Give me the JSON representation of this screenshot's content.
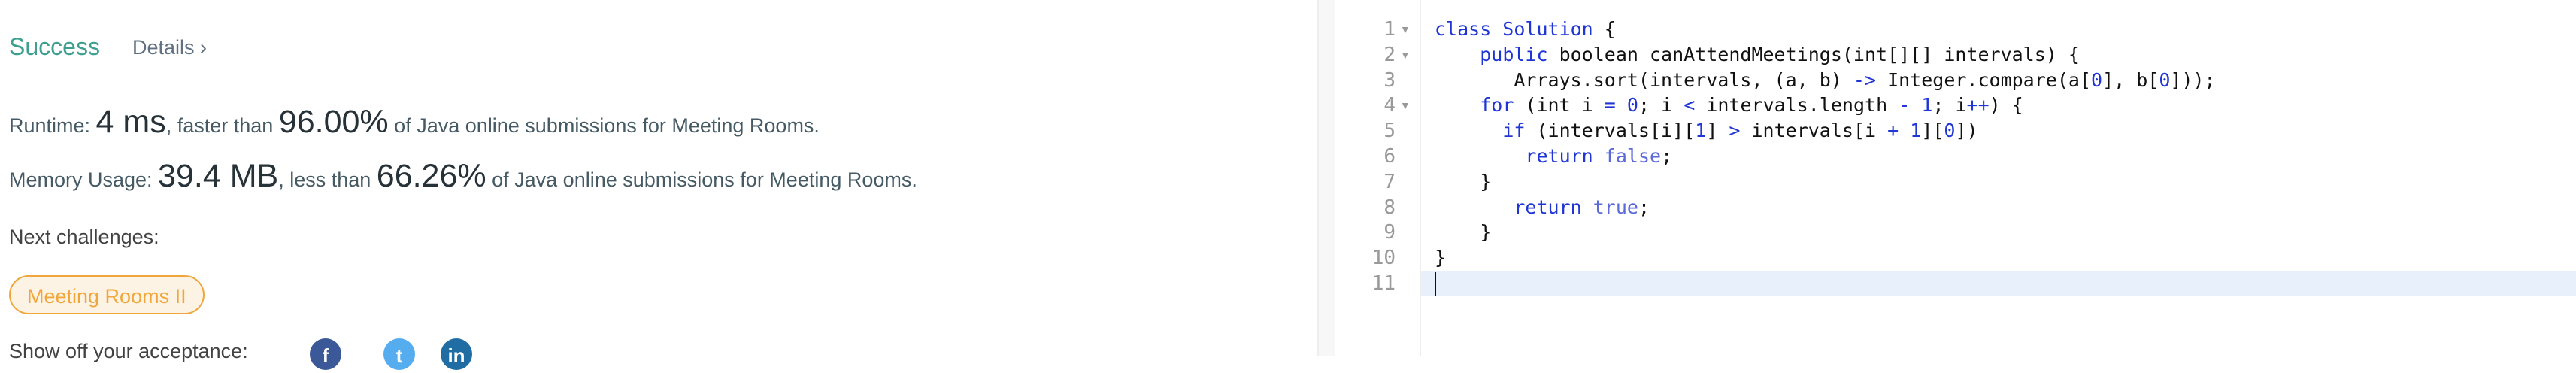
{
  "result": {
    "status": "Success",
    "details_label": "Details ›",
    "runtime": {
      "label": "Runtime: ",
      "value": "4 ms",
      "mid": ", faster than ",
      "percent": "96.00%",
      "tail": " of Java online submissions for Meeting Rooms."
    },
    "memory": {
      "label": "Memory Usage: ",
      "value": "39.4 MB",
      "mid": ", less than ",
      "percent": "66.26%",
      "tail": " of Java online submissions for Meeting Rooms."
    },
    "next_label": "Next challenges:",
    "next_items": [
      "Meeting Rooms II"
    ],
    "share_label": "Show off your acceptance:",
    "share_icons": [
      {
        "name": "facebook-icon",
        "glyph": "f",
        "color": "#3b5998"
      },
      {
        "name": "twitter-icon",
        "glyph": "t",
        "color": "#55acee"
      },
      {
        "name": "linkedin-icon",
        "glyph": "in",
        "color": "#1f6da3"
      }
    ],
    "colors": {
      "success": "#3d9f8f",
      "challenge": "#f0a63a"
    }
  },
  "editor": {
    "lines": [
      {
        "n": "1",
        "fold": true,
        "tokens": [
          [
            "class Solution",
            "kw"
          ],
          [
            " {",
            ""
          ]
        ]
      },
      {
        "n": "2",
        "fold": true,
        "tokens": [
          [
            "    ",
            ""
          ],
          [
            "public",
            "kw"
          ],
          [
            " boolean canAttendMeetings(int[][] intervals) {",
            ""
          ]
        ]
      },
      {
        "n": "3",
        "fold": false,
        "tokens": [
          [
            "       Arrays.sort(intervals, (a, b) ",
            ""
          ],
          [
            "->",
            "op"
          ],
          [
            " Integer.compare(a[",
            ""
          ],
          [
            "0",
            "num"
          ],
          [
            "], b[",
            ""
          ],
          [
            "0",
            "num"
          ],
          [
            "]));",
            ""
          ]
        ]
      },
      {
        "n": "4",
        "fold": true,
        "tokens": [
          [
            "    ",
            ""
          ],
          [
            "for",
            "kw"
          ],
          [
            " (int i ",
            ""
          ],
          [
            "=",
            "op"
          ],
          [
            " ",
            ""
          ],
          [
            "0",
            "num"
          ],
          [
            "; i ",
            ""
          ],
          [
            "<",
            "op"
          ],
          [
            " intervals.length ",
            ""
          ],
          [
            "-",
            "op"
          ],
          [
            " ",
            ""
          ],
          [
            "1",
            "num"
          ],
          [
            "; i",
            ""
          ],
          [
            "++",
            "op"
          ],
          [
            ") {",
            ""
          ]
        ]
      },
      {
        "n": "5",
        "fold": false,
        "tokens": [
          [
            "      ",
            ""
          ],
          [
            "if",
            "kw"
          ],
          [
            " (intervals[i][",
            ""
          ],
          [
            "1",
            "num"
          ],
          [
            "] ",
            ""
          ],
          [
            ">",
            "op"
          ],
          [
            " intervals[i ",
            ""
          ],
          [
            "+",
            "op"
          ],
          [
            " ",
            ""
          ],
          [
            "1",
            "num"
          ],
          [
            "][",
            ""
          ],
          [
            "0",
            "num"
          ],
          [
            "])",
            ""
          ]
        ]
      },
      {
        "n": "6",
        "fold": false,
        "tokens": [
          [
            "        ",
            ""
          ],
          [
            "return",
            "kw"
          ],
          [
            " ",
            ""
          ],
          [
            "false",
            "lit"
          ],
          [
            ";",
            ""
          ]
        ]
      },
      {
        "n": "7",
        "fold": false,
        "tokens": [
          [
            "    }",
            ""
          ]
        ]
      },
      {
        "n": "8",
        "fold": false,
        "tokens": [
          [
            "       ",
            ""
          ],
          [
            "return",
            "kw"
          ],
          [
            " ",
            ""
          ],
          [
            "true",
            "lit"
          ],
          [
            ";",
            ""
          ]
        ]
      },
      {
        "n": "9",
        "fold": false,
        "tokens": [
          [
            "    }",
            ""
          ]
        ]
      },
      {
        "n": "10",
        "fold": false,
        "tokens": [
          [
            "}",
            ""
          ]
        ]
      },
      {
        "n": "11",
        "fold": false,
        "tokens": []
      }
    ]
  }
}
